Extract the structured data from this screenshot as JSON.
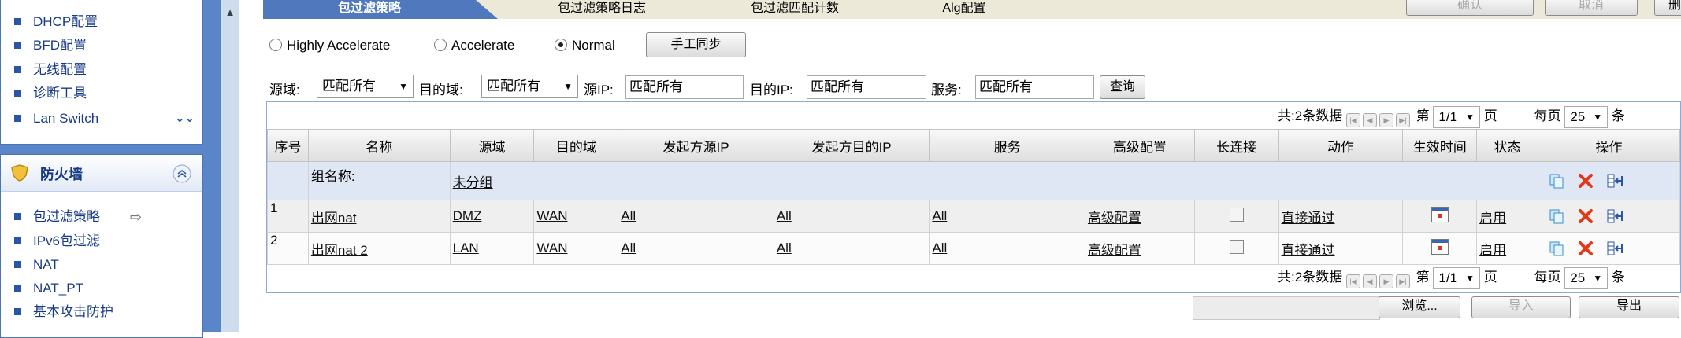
{
  "sidebar": {
    "panel1_items": [
      {
        "label": "DHCP配置"
      },
      {
        "label": "BFD配置"
      },
      {
        "label": "无线配置"
      },
      {
        "label": "诊断工具"
      },
      {
        "label": "Lan Switch"
      }
    ],
    "firewall_title": "防火墙",
    "panel2_items": [
      {
        "label": "包过滤策略"
      },
      {
        "label": "IPv6包过滤"
      },
      {
        "label": "NAT"
      },
      {
        "label": "NAT_PT"
      },
      {
        "label": "基本攻击防护"
      }
    ]
  },
  "tabs": [
    "包过滤策略",
    "包过滤策略日志",
    "包过滤匹配计数",
    "Alg配置"
  ],
  "top_buttons": {
    "confirm": "确认",
    "cancel": "取消",
    "delete_all": "删除所有"
  },
  "modes": {
    "highly_accelerate": "Highly Accelerate",
    "accelerate": "Accelerate",
    "normal": "Normal",
    "selected": "Normal"
  },
  "manual_sync": "手工同步",
  "filter": {
    "src_zone_label": "源域:",
    "src_zone_value": "匹配所有",
    "dst_zone_label": "目的域:",
    "dst_zone_value": "匹配所有",
    "src_ip_label": "源IP:",
    "src_ip_value": "匹配所有",
    "dst_ip_label": "目的IP:",
    "dst_ip_value": "匹配所有",
    "service_label": "服务:",
    "service_value": "匹配所有",
    "query_button": "查询"
  },
  "pager": {
    "total_prefix": "共:",
    "total_text": "2条数据",
    "page_prefix": "第",
    "page_value": "1/1",
    "page_suffix": "页",
    "per_page_prefix": "每页",
    "per_page_value": "25",
    "per_page_suffix": "条"
  },
  "columns": [
    "序号",
    "名称",
    "源域",
    "目的域",
    "发起方源IP",
    "发起方目的IP",
    "服务",
    "高级配置",
    "长连接",
    "动作",
    "生效时间",
    "状态",
    "操作"
  ],
  "group": {
    "label": "组名称:",
    "name": "未分组"
  },
  "rows": [
    {
      "no": "1",
      "name": "出网nat",
      "src": "DMZ",
      "dst": "WAN",
      "src_ip": "All",
      "dst_ip": "All",
      "service": "All",
      "advanced": "高级配置",
      "action": "直接通过",
      "status": "启用"
    },
    {
      "no": "2",
      "name": "出网nat 2",
      "src": "LAN",
      "dst": "WAN",
      "src_ip": "All",
      "dst_ip": "All",
      "service": "All",
      "advanced": "高级配置",
      "action": "直接通过",
      "status": "启用"
    }
  ],
  "bottom_buttons": {
    "browse": "浏览...",
    "import": "导入",
    "export": "导出"
  },
  "colors": {
    "sidebar_bg": "#5a86c9",
    "active_tab": "#4f78bd",
    "link": "#173a87"
  }
}
